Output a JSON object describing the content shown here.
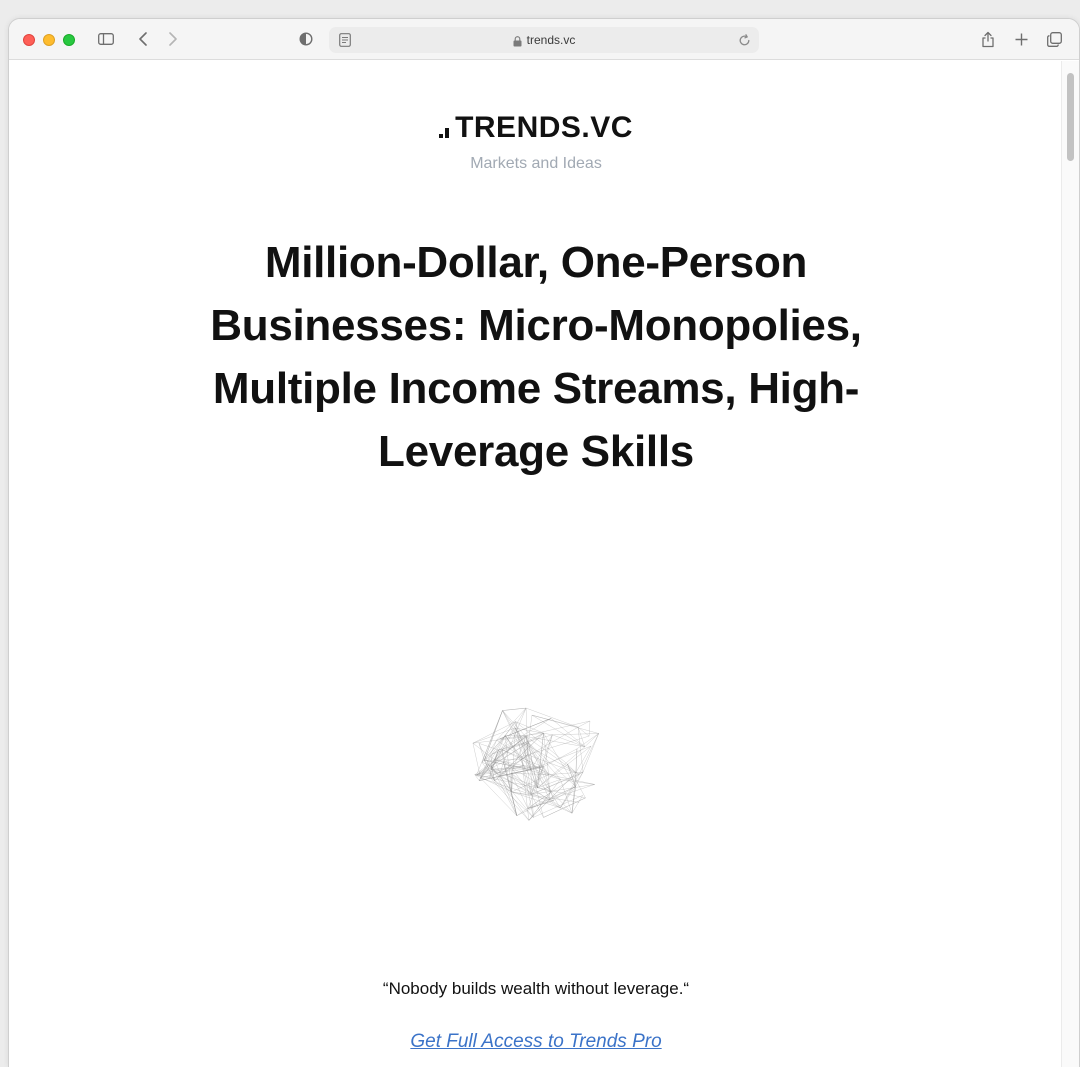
{
  "browser": {
    "url": "trends.vc"
  },
  "site": {
    "logo_text": "TRENDS.VC",
    "tagline": "Markets and Ideas"
  },
  "article": {
    "title": "Million-Dollar, One-Person Businesses: Micro-Monopolies, Multiple Income Streams, High-Leverage Skills",
    "quote": "“Nobody builds wealth without leverage.“",
    "cta_label": "Get Full Access to Trends Pro"
  },
  "colors": {
    "link": "#3b73c8",
    "tagline": "#a1a9b3",
    "network_stroke": "#8c8c8c"
  },
  "icons": [
    "sidebar-icon",
    "back-icon",
    "forward-icon",
    "shield-icon",
    "reader-icon",
    "lock-icon",
    "reload-icon",
    "share-icon",
    "new-tab-icon",
    "tabs-overview-icon"
  ]
}
